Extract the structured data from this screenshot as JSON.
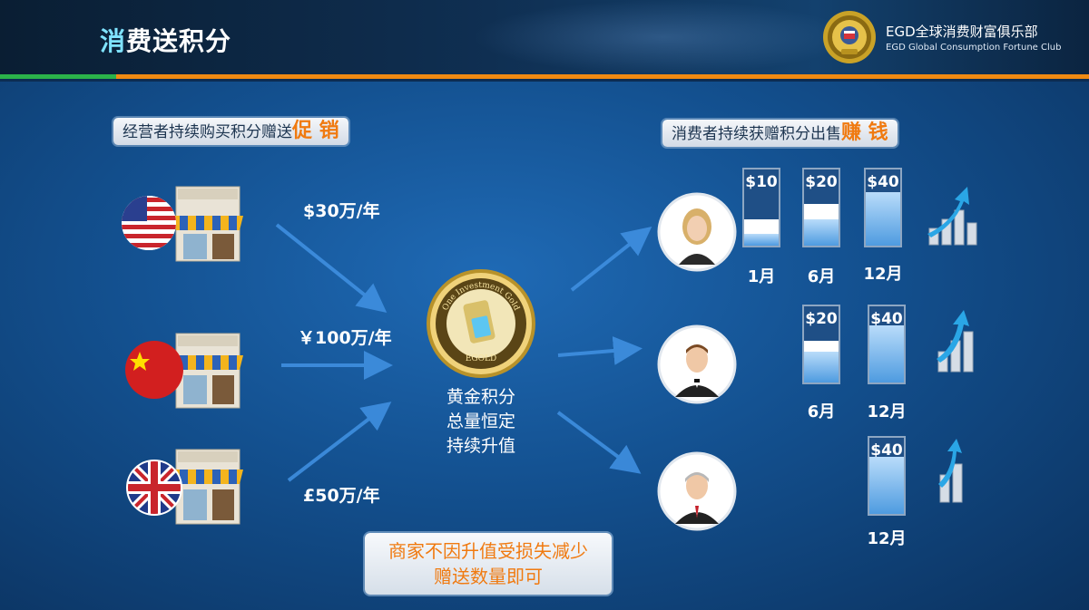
{
  "header": {
    "title": "消费送积分",
    "logo_cn": "EGD全球消费财富俱乐部",
    "logo_en": "EGD Global Consumption Fortune Club"
  },
  "left_banner": {
    "text": "经营者持续购买积分赠送",
    "highlight": "促 销"
  },
  "right_banner": {
    "text": "消费者持续获赠积分出售",
    "highlight": "赚 钱"
  },
  "merchants": [
    {
      "flag": "usa-flag",
      "rate": "$30万/年"
    },
    {
      "flag": "china-flag",
      "rate": "￥100万/年"
    },
    {
      "flag": "uk-flag",
      "rate": "£50万/年"
    }
  ],
  "coin": {
    "ring_text_top": "One Investment Gold",
    "ring_text_bottom": "EGOLD",
    "caption": [
      "黄金积分",
      "总量恒定",
      "持续升值"
    ]
  },
  "consumers": [
    {
      "avatar": "woman-avatar",
      "bars": [
        {
          "value": "$10",
          "month": "1月",
          "fill": 0.15
        },
        {
          "value": "$20",
          "month": "6月",
          "fill": 0.35
        },
        {
          "value": "$40",
          "month": "12月",
          "fill": 0.7
        }
      ]
    },
    {
      "avatar": "man-avatar",
      "bars": [
        {
          "value": "$20",
          "month": "6月",
          "fill": 0.4
        },
        {
          "value": "$40",
          "month": "12月",
          "fill": 0.75
        }
      ]
    },
    {
      "avatar": "senior-man-avatar",
      "bars": [
        {
          "value": "$40",
          "month": "12月",
          "fill": 0.75
        }
      ]
    }
  ],
  "note": [
    "商家不因升值受损失减少",
    "赠送数量即可"
  ],
  "colors": {
    "accent_orange": "#f07a10",
    "accent_green": "#2bb34a",
    "bar_top": "#1f4f86"
  }
}
